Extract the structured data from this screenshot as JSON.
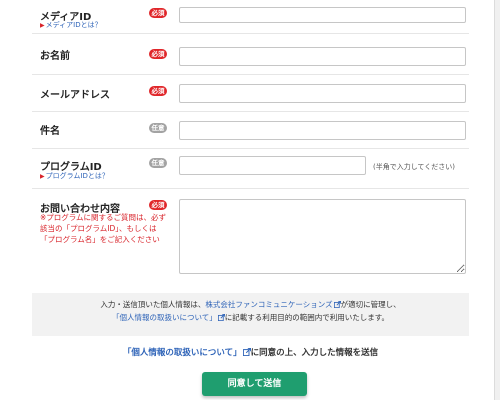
{
  "form": {
    "fields": [
      {
        "label": "メディアID",
        "badge": "必須",
        "badge_type": "required",
        "sublink": "メディアIDとは？",
        "value": "",
        "placeholder": ""
      },
      {
        "label": "お名前",
        "badge": "必須",
        "badge_type": "required",
        "value": "",
        "placeholder": ""
      },
      {
        "label": "メールアドレス",
        "badge": "必須",
        "badge_type": "required",
        "value": "",
        "placeholder": ""
      },
      {
        "label": "件名",
        "badge": "任意",
        "badge_type": "optional",
        "value": "",
        "placeholder": ""
      },
      {
        "label": "プログラムID",
        "badge": "任意",
        "badge_type": "optional",
        "sublink": "プログラムIDとは？",
        "hint": "(半角で入力してください)",
        "value": "",
        "placeholder": ""
      },
      {
        "label": "お問い合わせ内容",
        "badge": "必須",
        "badge_type": "required",
        "note": "※プログラムに関するご質問は、必ず該当の「プログラムID」、もしくは「プログラム名」をご記入ください",
        "value": "",
        "placeholder": ""
      }
    ]
  },
  "privacy": {
    "line1_prefix": "入力・送信頂いた個人情報は、",
    "line1_link": "株式会社ファンコミュニケーションズ",
    "line1_suffix": "が適切に管理し、",
    "line2_link": "「個人情報の取扱いについて」",
    "line2_suffix": "に記載する利用目的の範囲内で利用いたします。"
  },
  "consent": {
    "link": "「個人情報の取扱いについて」",
    "suffix": "に同意の上、入力した情報を送信"
  },
  "submit_label": "同意して送信",
  "colors": {
    "required": "#e0262a",
    "optional": "#a3a3a3",
    "link": "#2f64b8",
    "submit": "#1f9e6f"
  }
}
